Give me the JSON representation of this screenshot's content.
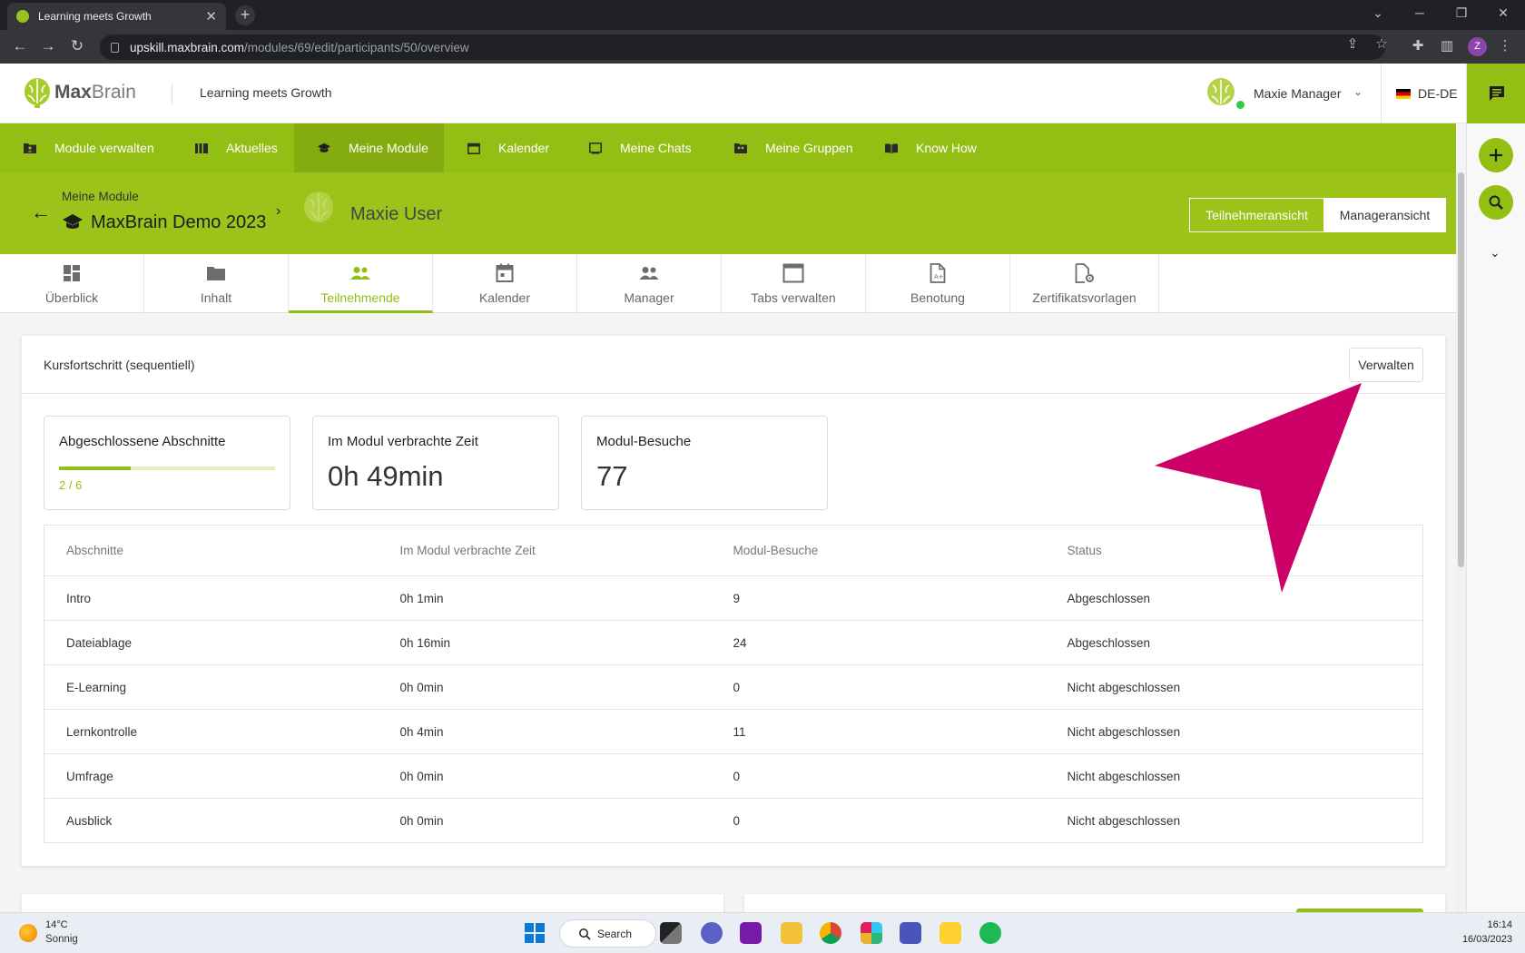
{
  "browser": {
    "tab_title": "Learning meets Growth",
    "url_host": "upskill.maxbrain.com",
    "url_path": "/modules/69/edit/participants/50/overview",
    "profile_initial": "Z"
  },
  "header": {
    "logo_bold": "Max",
    "logo_light": "Brain",
    "slogan": "Learning meets Growth",
    "user_name": "Maxie Manager",
    "language": "DE-DE"
  },
  "nav": {
    "items": [
      {
        "label": "Module verwalten",
        "icon": "folder-user-icon"
      },
      {
        "label": "Aktuelles",
        "icon": "news-icon"
      },
      {
        "label": "Meine Module",
        "icon": "graduation-cap-icon"
      },
      {
        "label": "Kalender",
        "icon": "calendar-icon"
      },
      {
        "label": "Meine Chats",
        "icon": "chat-icon"
      },
      {
        "label": "Meine Gruppen",
        "icon": "group-icon"
      },
      {
        "label": "Know How",
        "icon": "book-icon"
      }
    ],
    "active_index": 2
  },
  "module": {
    "breadcrumb_parent": "Meine Module",
    "title": "MaxBrain Demo 2023",
    "participant_name": "Maxie User",
    "view_participant": "Teilnehmeransicht",
    "view_manager": "Manageransicht"
  },
  "tabs": [
    {
      "label": "Überblick",
      "icon": "dashboard-icon"
    },
    {
      "label": "Inhalt",
      "icon": "folder-icon"
    },
    {
      "label": "Teilnehmende",
      "icon": "participants-icon"
    },
    {
      "label": "Kalender",
      "icon": "calendar-icon"
    },
    {
      "label": "Manager",
      "icon": "managers-icon"
    },
    {
      "label": "Tabs verwalten",
      "icon": "window-tabs-icon"
    },
    {
      "label": "Benotung",
      "icon": "grade-document-icon"
    },
    {
      "label": "Zertifikatsvorlagen",
      "icon": "certificate-settings-icon"
    }
  ],
  "card": {
    "title": "Kursfortschritt (sequentiell)",
    "manage_label": "Verwalten",
    "stats": {
      "completed_label": "Abgeschlossene Abschnitte",
      "completed_text": "2 / 6",
      "completed_done": 2,
      "completed_total": 6,
      "time_label": "Im Modul verbrachte Zeit",
      "time_value": "0h 49min",
      "visits_label": "Modul-Besuche",
      "visits_value": "77"
    },
    "table": {
      "columns": [
        "Abschnitte",
        "Im Modul verbrachte Zeit",
        "Modul-Besuche",
        "Status"
      ],
      "rows": [
        [
          "Intro",
          "0h 1min",
          "9",
          "Abgeschlossen"
        ],
        [
          "Dateiablage",
          "0h 16min",
          "24",
          "Abgeschlossen"
        ],
        [
          "E-Learning",
          "0h 0min",
          "0",
          "Nicht abgeschlossen"
        ],
        [
          "Lernkontrolle",
          "0h 4min",
          "11",
          "Nicht abgeschlossen"
        ],
        [
          "Umfrage",
          "0h 0min",
          "0",
          "Nicht abgeschlossen"
        ],
        [
          "Ausblick",
          "0h 0min",
          "0",
          "Nicht abgeschlossen"
        ]
      ]
    }
  },
  "taskbar": {
    "weather_temp": "14°C",
    "weather_desc": "Sonnig",
    "search_label": "Search",
    "time": "16:14",
    "date": "16/03/2023"
  },
  "colors": {
    "brand_green": "#93be14",
    "annotation_magenta": "#cc0066"
  }
}
